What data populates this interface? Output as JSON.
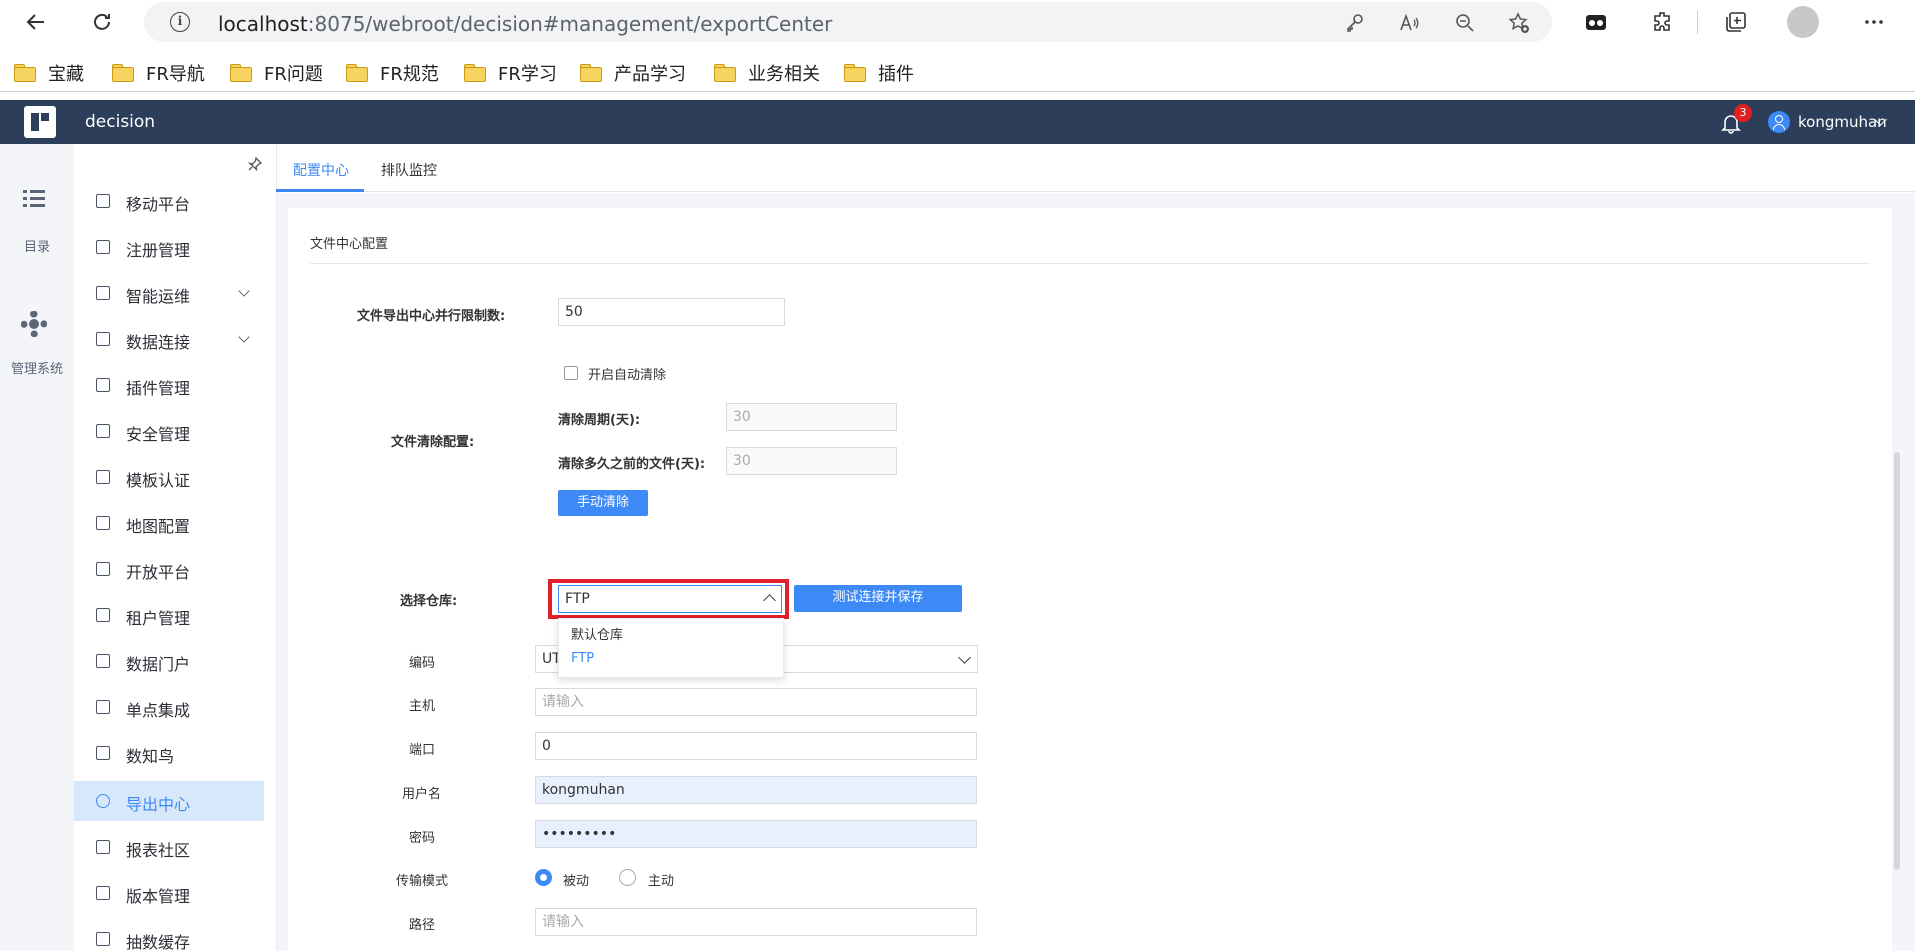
{
  "browser": {
    "url_host": "localhost",
    "url_rest": ":8075/webroot/decision#management/exportCenter",
    "bookmarks": [
      "宝藏",
      "FR导航",
      "FR问题",
      "FR规范",
      "FR学习",
      "产品学习",
      "业务相关",
      "插件"
    ]
  },
  "header": {
    "app_title": "decision",
    "notification_count": "3",
    "user_name": "kongmuhan"
  },
  "rail": {
    "catalog_label": "目录",
    "system_label": "管理系统"
  },
  "menu": {
    "items": [
      {
        "label": "移动平台",
        "icon": "mobile-icon"
      },
      {
        "label": "注册管理",
        "icon": "register-icon"
      },
      {
        "label": "智能运维",
        "icon": "ops-icon",
        "expandable": true
      },
      {
        "label": "数据连接",
        "icon": "link-icon",
        "expandable": true
      },
      {
        "label": "插件管理",
        "icon": "plugin-icon"
      },
      {
        "label": "安全管理",
        "icon": "shield-icon"
      },
      {
        "label": "模板认证",
        "icon": "template-icon"
      },
      {
        "label": "地图配置",
        "icon": "map-icon"
      },
      {
        "label": "开放平台",
        "icon": "open-platform-icon"
      },
      {
        "label": "租户管理",
        "icon": "tenant-icon"
      },
      {
        "label": "数据门户",
        "icon": "portal-icon"
      },
      {
        "label": "单点集成",
        "icon": "sso-icon"
      },
      {
        "label": "数知鸟",
        "icon": "bird-icon"
      },
      {
        "label": "导出中心",
        "icon": "gear-icon",
        "active": true
      },
      {
        "label": "报表社区",
        "icon": "gear-icon"
      },
      {
        "label": "版本管理",
        "icon": "gear-icon"
      },
      {
        "label": "抽数缓存",
        "icon": "gear-icon"
      }
    ]
  },
  "tabs": [
    "配置中心",
    "排队监控"
  ],
  "panel": {
    "title": "文件中心配置",
    "concurrency_label": "文件导出中心并行限制数:",
    "concurrency_value": "50",
    "cleanup_label": "文件清除配置:",
    "auto_clean_label": "开启自动清除",
    "auto_clean_checked": false,
    "period_label": "清除周期(天):",
    "period_value": "30",
    "age_label": "清除多久之前的文件(天):",
    "age_value": "30",
    "manual_clean_button": "手动清除",
    "repo_label": "选择仓库:",
    "repo_value": "FTP",
    "repo_options": [
      "默认仓库",
      "FTP"
    ],
    "test_save_button": "测试连接并保存",
    "encoding_label": "编码",
    "encoding_value": "UT",
    "host_label": "主机",
    "host_placeholder": "请输入",
    "port_label": "端口",
    "port_value": "0",
    "username_label": "用户名",
    "username_value": "kongmuhan",
    "password_label": "密码",
    "password_value": "•••••••••",
    "mode_label": "传输模式",
    "mode_passive": "被动",
    "mode_active": "主动",
    "mode_selected": "被动",
    "path_label": "路径",
    "path_placeholder": "请输入"
  },
  "colors": {
    "accent": "#3d8af7",
    "header_bg": "#2c3e5a",
    "highlight_border": "#e0202a"
  }
}
